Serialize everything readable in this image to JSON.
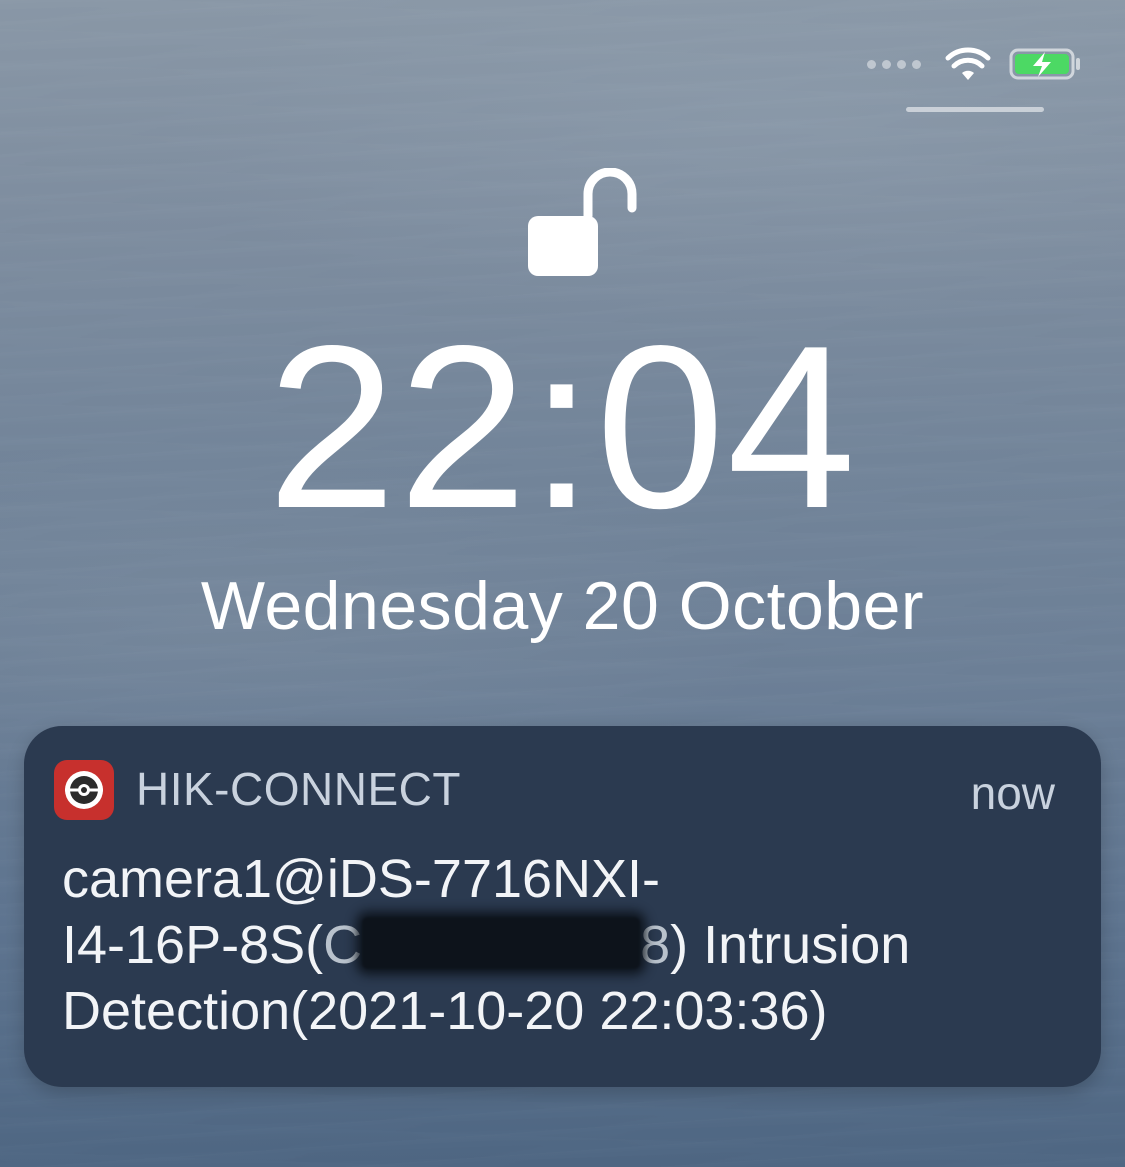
{
  "lockscreen": {
    "time": "22:04",
    "date": "Wednesday 20 October"
  },
  "status_bar": {
    "icons": [
      "cellular-dots-icon",
      "wifi-icon",
      "battery-charging-icon"
    ],
    "battery_color": "#4cd964"
  },
  "notification": {
    "app_name": "HIK-CONNECT",
    "time": "now",
    "message_part1": "camera1@iDS-7716NXI-\nI4-16P-8S(",
    "redacted_visible_prefix": "C",
    "redacted_visible_suffix": "8",
    "message_part2": ") Intrusion\nDetection(2021-10-20 22:03:36)",
    "app_icon_color": "#c7302d"
  }
}
